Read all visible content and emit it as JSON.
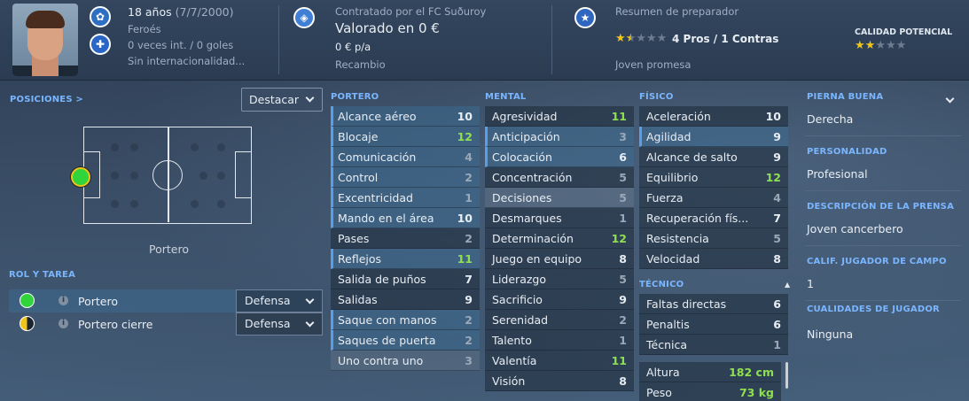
{
  "header": {
    "age": "18 años",
    "dob": "(7/7/2000)",
    "nationality": "Feroés",
    "intl_record": "0 veces int. / 0 goles",
    "intl_status": "Sin internacionalidad...",
    "contract": "Contratado por el FC Suðuroy",
    "value": "Valorado en 0 €",
    "wage": "0 € p/a",
    "squad_status": "Recambio",
    "coach_summary_title": "Resumen de preparador",
    "coach_rating_stars": 1.5,
    "pros_cons": "4 Pros / 1 Contras",
    "coach_verdict": "Joven promesa",
    "potential_label": "CALIDAD POTENCIAL",
    "potential_stars": 2
  },
  "positions": {
    "title": "POSICIONES >",
    "highlight_dropdown": "Destacar",
    "position_name": "Portero"
  },
  "roles": {
    "title": "ROL Y TAREA",
    "items": [
      {
        "name": "Portero",
        "duty": "Defensa",
        "icon_color": "#2fd53a"
      },
      {
        "name": "Portero cierre",
        "duty": "Defensa",
        "icon_color": "#f0c419"
      }
    ]
  },
  "attributes": {
    "goalkeeping": {
      "title": "PORTERO",
      "rows": [
        {
          "name": "Alcance aéreo",
          "value": "10"
        },
        {
          "name": "Blocaje",
          "value": "12"
        },
        {
          "name": "Comunicación",
          "value": "4"
        },
        {
          "name": "Control",
          "value": "2"
        },
        {
          "name": "Excentricidad",
          "value": "1"
        },
        {
          "name": "Mando en el área",
          "value": "10"
        },
        {
          "name": "Pases",
          "value": "2"
        },
        {
          "name": "Reflejos",
          "value": "11"
        },
        {
          "name": "Salida de puños",
          "value": "7"
        },
        {
          "name": "Salidas",
          "value": "9"
        },
        {
          "name": "Saque con manos",
          "value": "2"
        },
        {
          "name": "Saques de puerta",
          "value": "2"
        },
        {
          "name": "Uno contra uno",
          "value": "3"
        }
      ]
    },
    "mental": {
      "title": "MENTAL",
      "rows": [
        {
          "name": "Agresividad",
          "value": "11"
        },
        {
          "name": "Anticipación",
          "value": "3"
        },
        {
          "name": "Colocación",
          "value": "6"
        },
        {
          "name": "Concentración",
          "value": "5"
        },
        {
          "name": "Decisiones",
          "value": "5"
        },
        {
          "name": "Desmarques",
          "value": "1"
        },
        {
          "name": "Determinación",
          "value": "12"
        },
        {
          "name": "Juego en equipo",
          "value": "8"
        },
        {
          "name": "Liderazgo",
          "value": "5"
        },
        {
          "name": "Sacrificio",
          "value": "9"
        },
        {
          "name": "Serenidad",
          "value": "2"
        },
        {
          "name": "Talento",
          "value": "1"
        },
        {
          "name": "Valentía",
          "value": "11"
        },
        {
          "name": "Visión",
          "value": "8"
        }
      ]
    },
    "physical": {
      "title": "FÍSICO",
      "rows": [
        {
          "name": "Aceleración",
          "value": "10"
        },
        {
          "name": "Agilidad",
          "value": "9"
        },
        {
          "name": "Alcance de salto",
          "value": "9"
        },
        {
          "name": "Equilibrio",
          "value": "12"
        },
        {
          "name": "Fuerza",
          "value": "4"
        },
        {
          "name": "Recuperación fís...",
          "value": "7"
        },
        {
          "name": "Resistencia",
          "value": "5"
        },
        {
          "name": "Velocidad",
          "value": "8"
        }
      ]
    },
    "technical": {
      "title": "TÉCNICO",
      "rows": [
        {
          "name": "Faltas directas",
          "value": "6"
        },
        {
          "name": "Penaltis",
          "value": "6"
        },
        {
          "name": "Técnica",
          "value": "1"
        }
      ]
    },
    "body": [
      {
        "name": "Altura",
        "value": "182 cm"
      },
      {
        "name": "Peso",
        "value": "73 kg"
      }
    ]
  },
  "info": {
    "foot_label": "PIERNA BUENA",
    "foot_value": "Derecha",
    "personality_label": "PERSONALIDAD",
    "personality_value": "Profesional",
    "press_label": "DESCRIPCIÓN DE LA PRENSA",
    "press_value": "Joven cancerbero",
    "outfield_label": "CALIF. JUGADOR DE CAMPO",
    "outfield_value": "1",
    "qualities_label": "CUALIDADES DE JUGADOR",
    "qualities_value": "Ninguna"
  },
  "colors": {
    "accent": "#7ab6ff",
    "highlight_value": "#8fe04f",
    "star": "#f0c419"
  }
}
